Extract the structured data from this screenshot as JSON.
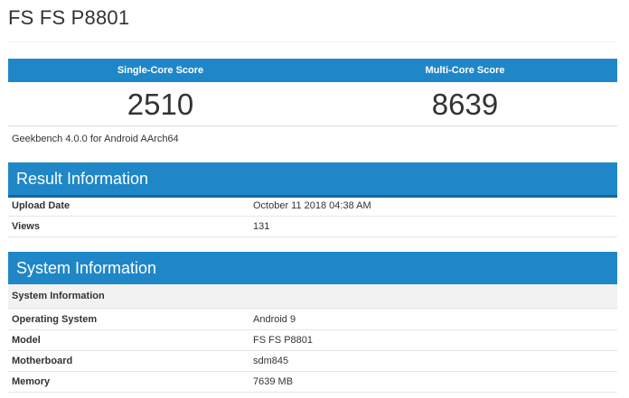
{
  "page": {
    "title": "FS FS P8801"
  },
  "scores": {
    "single_label": "Single-Core Score",
    "multi_label": "Multi-Core Score",
    "single_value": "2510",
    "multi_value": "8639"
  },
  "benchmark_version": "Geekbench 4.0.0 for Android AArch64",
  "result_info": {
    "title": "Result Information",
    "rows": [
      {
        "key": "Upload Date",
        "value": "October 11 2018 04:38 AM"
      },
      {
        "key": "Views",
        "value": "131"
      }
    ]
  },
  "system_info": {
    "title": "System Information",
    "subheading": "System Information",
    "rows": [
      {
        "key": "Operating System",
        "value": "Android 9"
      },
      {
        "key": "Model",
        "value": "FS FS P8801"
      },
      {
        "key": "Motherboard",
        "value": "sdm845"
      },
      {
        "key": "Memory",
        "value": "7639 MB"
      }
    ]
  },
  "colors": {
    "header_blue": "#1f87c8",
    "header_underline": "#15679a"
  }
}
